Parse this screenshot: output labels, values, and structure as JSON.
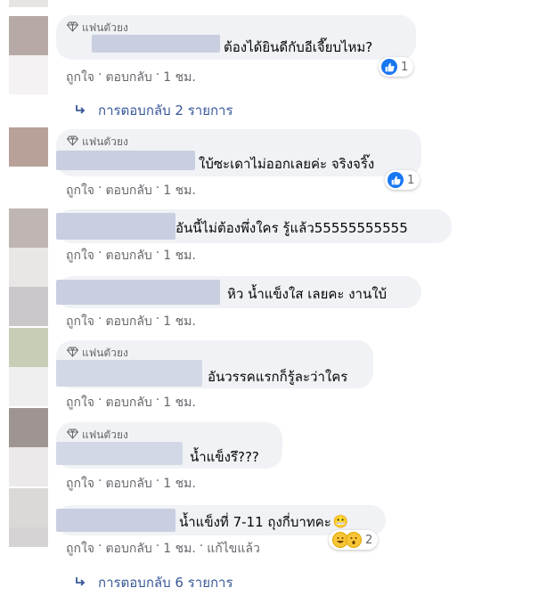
{
  "badge_label": "แฟนตัวยง",
  "action_labels": {
    "like": "ถูกใจ",
    "reply": "ตอบกลับ",
    "dot": "·"
  },
  "comments": [
    {
      "text": "ต้องได้ยินดีกับอีเจี๊ยบไหม?",
      "has_badge": true,
      "time": "1 ชม.",
      "reaction_count": "1",
      "reaction_type": "like"
    },
    {
      "text": "ใบ้ซะเดาไม่ออกเลยค่ะ จริงจริ๊ง",
      "has_badge": true,
      "time": "1 ชม.",
      "reaction_count": "1",
      "reaction_type": "like"
    },
    {
      "text": "อันนี้ไม่ต้องพึ่งใคร รู้แล้ว55555555555",
      "has_badge": false,
      "time": "1 ชม."
    },
    {
      "text": "หิว น้ำแข็งใส เลยคะ งานใบ้",
      "has_badge": false,
      "time": "1 ชม."
    },
    {
      "text": "อันวรรคแรกก็รู้ละว่าใคร",
      "has_badge": true,
      "time": "1 ชม."
    },
    {
      "text": "น้ำแข็งรึ???",
      "has_badge": true,
      "time": "1 ชม."
    },
    {
      "text": "น้ำแข็งที่ 7-11 ถุงกี่บาทคะ",
      "has_badge": false,
      "time": "1 ชม.",
      "edited": "แก้ไขแล้ว",
      "reaction_count": "2",
      "reaction_type": "haha-wow",
      "trailing_emoji": "😬"
    }
  ],
  "reply_links": [
    {
      "label": "การตอบกลับ 2 รายการ"
    },
    {
      "label": "การตอบกลับ 6 รายการ"
    }
  ],
  "colors": {
    "bubble_bg": "#f0f2f5",
    "meta_text": "#65676b",
    "link_blue": "#385898",
    "like_blue": "#1877f2"
  }
}
